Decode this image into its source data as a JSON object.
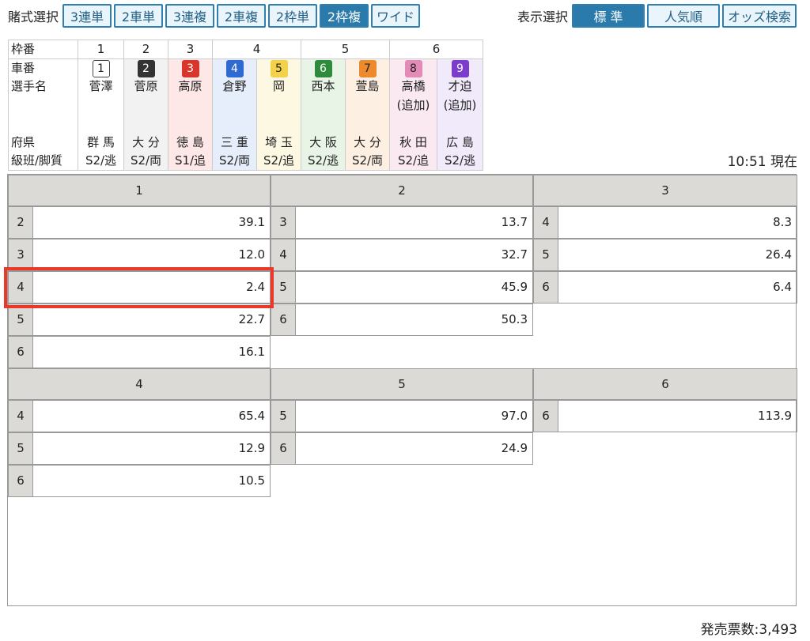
{
  "toolbar": {
    "bet_label": "賭式選択",
    "bet_buttons": [
      "3連単",
      "2車単",
      "3連複",
      "2車複",
      "2枠単",
      "2枠複",
      "ワイド"
    ],
    "active_bet_index": 5,
    "view_label": "表示選択",
    "view_buttons": [
      "標 準",
      "人気順",
      "オッズ検索"
    ],
    "active_view_index": 0
  },
  "info": {
    "labels": {
      "waku": "枠番",
      "car": "車番",
      "name": "選手名",
      "pref": "府県",
      "class": "級班/脚質"
    },
    "waku_numbers": [
      "1",
      "2",
      "3",
      "4",
      "5",
      "6"
    ],
    "riders": [
      {
        "car": "1",
        "name": "菅澤",
        "name2": "",
        "pref": "群 馬",
        "cls": "S2/逃",
        "bg": "#ffffff",
        "box": "#ffffff",
        "fg": "#222222"
      },
      {
        "car": "2",
        "name": "菅原",
        "name2": "",
        "pref": "大 分",
        "cls": "S2/両",
        "bg": "#f2f2f2",
        "box": "#333333",
        "fg": "#ffffff"
      },
      {
        "car": "3",
        "name": "高原",
        "name2": "",
        "pref": "徳 島",
        "cls": "S1/追",
        "bg": "#fde7e7",
        "box": "#d9362b",
        "fg": "#ffffff"
      },
      {
        "car": "4",
        "name": "倉野",
        "name2": "",
        "pref": "三 重",
        "cls": "S2/両",
        "bg": "#e7eefb",
        "box": "#2f6ad0",
        "fg": "#ffffff"
      },
      {
        "car": "5",
        "name": "岡",
        "name2": "",
        "pref": "埼 玉",
        "cls": "S2/追",
        "bg": "#fcf8e2",
        "box": "#f3d249",
        "fg": "#222222"
      },
      {
        "car": "6",
        "name": "西本",
        "name2": "",
        "pref": "大 阪",
        "cls": "S2/逃",
        "bg": "#e8f5e6",
        "box": "#2e8b3c",
        "fg": "#ffffff"
      },
      {
        "car": "7",
        "name": "萱島",
        "name2": "",
        "pref": "大 分",
        "cls": "S2/両",
        "bg": "#fdf0e3",
        "box": "#ee8a2e",
        "fg": "#222222"
      },
      {
        "car": "8",
        "name": "高橋",
        "name2": "(追加)",
        "pref": "秋 田",
        "cls": "S2/追",
        "bg": "#fbe9f2",
        "box": "#e48ab6",
        "fg": "#222222"
      },
      {
        "car": "9",
        "name": "才迫",
        "name2": "(追加)",
        "pref": "広 島",
        "cls": "S2/逃",
        "bg": "#f0eafb",
        "box": "#7c3ccc",
        "fg": "#ffffff"
      }
    ]
  },
  "time": "10:51 現在",
  "odds": [
    {
      "head": "1",
      "rows": [
        [
          "2",
          "39.1"
        ],
        [
          "3",
          "12.0"
        ],
        [
          "4",
          "2.4"
        ],
        [
          "5",
          "22.7"
        ],
        [
          "6",
          "16.1"
        ]
      ]
    },
    {
      "head": "2",
      "rows": [
        [
          "3",
          "13.7"
        ],
        [
          "4",
          "32.7"
        ],
        [
          "5",
          "45.9"
        ],
        [
          "6",
          "50.3"
        ]
      ]
    },
    {
      "head": "3",
      "rows": [
        [
          "4",
          "8.3"
        ],
        [
          "5",
          "26.4"
        ],
        [
          "6",
          "6.4"
        ]
      ]
    },
    {
      "head": "4",
      "rows": [
        [
          "4",
          "65.4"
        ],
        [
          "5",
          "12.9"
        ],
        [
          "6",
          "10.5"
        ]
      ]
    },
    {
      "head": "5",
      "rows": [
        [
          "5",
          "97.0"
        ],
        [
          "6",
          "24.9"
        ]
      ]
    },
    {
      "head": "6",
      "rows": [
        [
          "6",
          "113.9"
        ]
      ]
    }
  ],
  "footer": "発売票数:3,493"
}
